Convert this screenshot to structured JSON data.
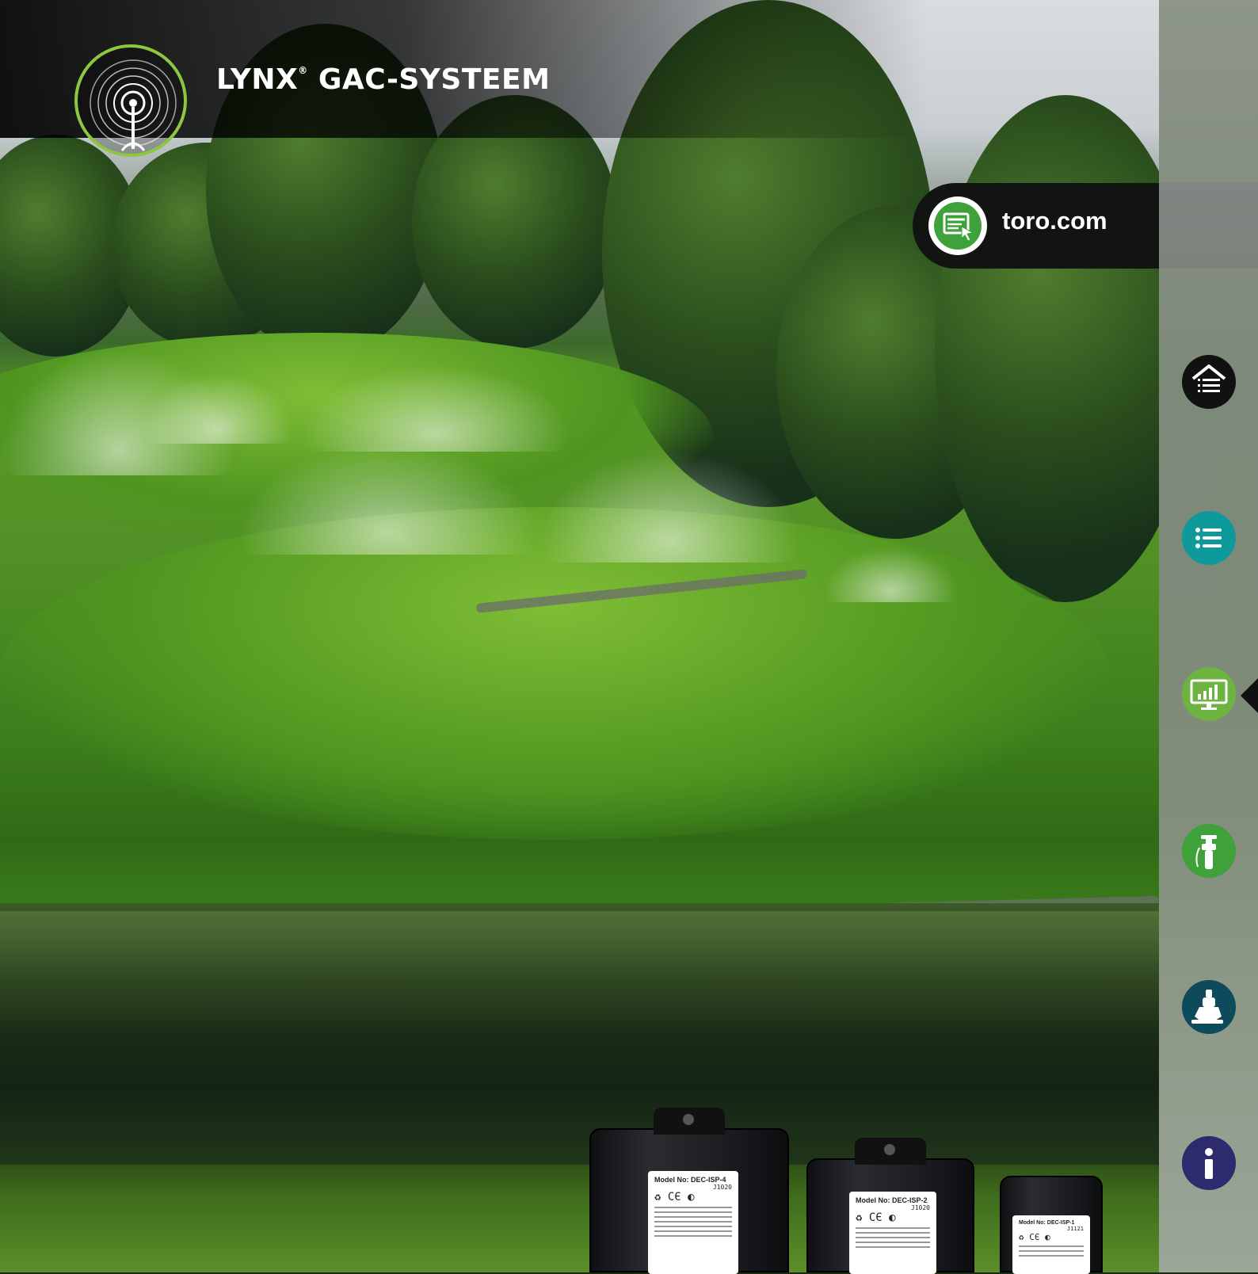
{
  "header": {
    "title": "LYNX",
    "title_mark": "®",
    "title_rest": " GAC-SYSTEEM"
  },
  "weblink": {
    "label": "toro.com",
    "icon": "web-browser-icon"
  },
  "sidebar": {
    "items": [
      {
        "name": "home",
        "icon": "home-menu-icon",
        "color": "#111111"
      },
      {
        "name": "contents",
        "icon": "list-icon",
        "color": "#0e9a9a"
      },
      {
        "name": "central-control",
        "icon": "monitor-chart-icon",
        "color": "#6db33f",
        "active": true
      },
      {
        "name": "sprinklers",
        "icon": "sprinkler-icon",
        "color": "#3fa13a"
      },
      {
        "name": "valves",
        "icon": "valve-icon",
        "color": "#0c4a5c"
      },
      {
        "name": "info",
        "icon": "info-icon",
        "color": "#2d2a6e"
      }
    ]
  },
  "devices": [
    {
      "model": "Model No: DEC-ISP-4",
      "code": "J1020"
    },
    {
      "model": "Model No: DEC-ISP-2",
      "code": "J1020"
    },
    {
      "model": "Model No: DEC-ISP-1",
      "code": "J1121"
    }
  ],
  "colors": {
    "brand_green": "#8dc63f",
    "header_black": "#000000"
  }
}
